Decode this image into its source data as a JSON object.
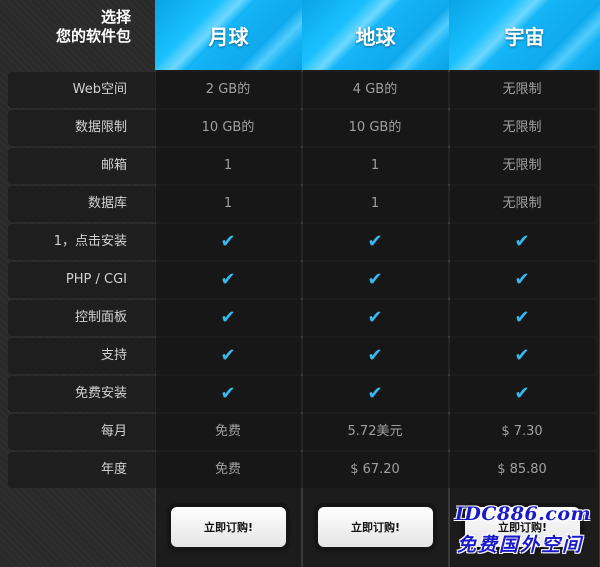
{
  "corner": {
    "line1": "选择",
    "line2": "您的软件包"
  },
  "plans": [
    {
      "name": "月球",
      "button": "立即订购!"
    },
    {
      "name": "地球",
      "button": "立即订购!"
    },
    {
      "name": "宇宙",
      "button": "立即订购!"
    }
  ],
  "rows": [
    {
      "label": "Web空间",
      "values": [
        "2 GB的",
        "4 GB的",
        "无限制"
      ]
    },
    {
      "label": "数据限制",
      "values": [
        "10 GB的",
        "10 GB的",
        "无限制"
      ]
    },
    {
      "label": "邮箱",
      "values": [
        "1",
        "1",
        "无限制"
      ]
    },
    {
      "label": "数据库",
      "values": [
        "1",
        "1",
        "无限制"
      ]
    },
    {
      "label": "1，点击安装",
      "values": [
        "✔",
        "✔",
        "✔"
      ]
    },
    {
      "label": "PHP / CGI",
      "values": [
        "✔",
        "✔",
        "✔"
      ]
    },
    {
      "label": "控制面板",
      "values": [
        "✔",
        "✔",
        "✔"
      ]
    },
    {
      "label": "支持",
      "values": [
        "✔",
        "✔",
        "✔"
      ]
    },
    {
      "label": "免费安装",
      "values": [
        "✔",
        "✔",
        "✔"
      ]
    },
    {
      "label": "每月",
      "values": [
        "免费",
        "5.72美元",
        "$ 7.30"
      ]
    },
    {
      "label": "年度",
      "values": [
        "免费",
        "$ 67.20",
        "$ 85.80"
      ]
    }
  ],
  "watermark": {
    "line1": "IDC886.com",
    "line2": "免费国外空间"
  },
  "colors": {
    "header_blue": "#14b0f3",
    "check_blue": "#38b8ec"
  }
}
